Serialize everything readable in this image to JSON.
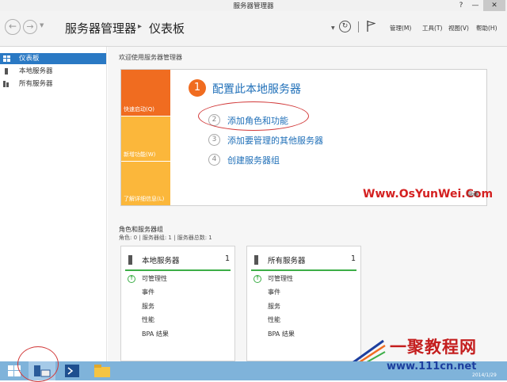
{
  "window": {
    "title": "服务器管理器",
    "help_btn": "?",
    "minimize_btn": "—",
    "close_btn": "✕"
  },
  "header": {
    "back_icon": "back-arrow-icon",
    "forward_icon": "forward-arrow-icon",
    "breadcrumb_root": "服务器管理器",
    "breadcrumb_sep": "▸",
    "breadcrumb_current": "仪表板",
    "menus": [
      "管理(M)",
      "工具(T)",
      "视图(V)",
      "帮助(H)"
    ]
  },
  "sidebar": {
    "items": [
      {
        "label": "仪表板",
        "selected": true
      },
      {
        "label": "本地服务器",
        "selected": false
      },
      {
        "label": "所有服务器",
        "selected": false
      }
    ]
  },
  "welcome": {
    "title": "欢迎使用服务器管理器"
  },
  "quickstart": {
    "tiles": [
      "快速启动(Q)",
      "新增功能(W)",
      "了解详细信息(L)"
    ],
    "steps": [
      {
        "num": "1",
        "label": "配置此本地服务器"
      },
      {
        "num": "2",
        "label": "添加角色和功能"
      },
      {
        "num": "3",
        "label": "添加要管理的其他服务器"
      },
      {
        "num": "4",
        "label": "创建服务器组"
      }
    ],
    "hide_label": "隐藏"
  },
  "roles": {
    "heading": "角色和服务器组",
    "subheading": "角色: 0 | 服务器组: 1 | 服务器总数: 1",
    "cards": [
      {
        "title": "本地服务器",
        "count": "1",
        "rows": [
          "可管理性",
          "事件",
          "服务",
          "性能",
          "BPA 结果"
        ]
      },
      {
        "title": "所有服务器",
        "count": "1",
        "rows": [
          "可管理性",
          "事件",
          "服务",
          "性能",
          "BPA 结果"
        ]
      }
    ]
  },
  "watermark": {
    "text": "Www.OsYunWei.Com"
  },
  "logo": {
    "line1": "一聚教程网",
    "line2": "www.111cn.net"
  },
  "taskbar": {
    "date": "2014/1/29"
  },
  "colors": {
    "accent_orange": "#f06c20",
    "tile_yellow": "#fbb73b",
    "link_blue": "#1f6fb8",
    "status_green": "#3cae47",
    "selected_blue": "#2a79c4",
    "taskbar": "#7fb3da"
  }
}
